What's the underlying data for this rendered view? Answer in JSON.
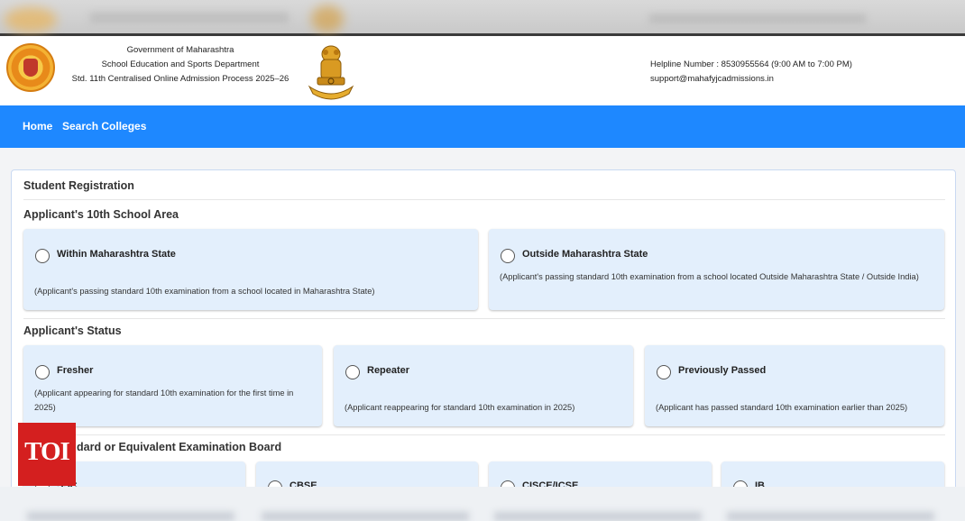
{
  "header": {
    "org_lines": [
      "Government of Maharashtra",
      "School Education and Sports Department",
      "Std. 11th Centralised Online Admission Process 2025–26"
    ],
    "helpline": "Helpline Number : 8530955564 (9:00 AM to 7:00 PM)",
    "email": "support@mahafyjcadmissions.in",
    "seal_icon": "maharashtra-seal-icon",
    "emblem_icon": "national-emblem-icon"
  },
  "nav": {
    "home": "Home",
    "search_colleges": "Search Colleges",
    "color": "#1e88ff"
  },
  "form": {
    "title": "Student Registration",
    "area": {
      "heading": "Applicant's 10th School Area",
      "options": [
        {
          "label": "Within Maharashtra State",
          "desc": "(Applicant's passing standard 10th examination from a school located in Maharashtra State)"
        },
        {
          "label": "Outside Maharashtra State",
          "desc": "(Applicant's passing standard 10th examination from a school located Outside Maharashtra State / Outside India)"
        }
      ]
    },
    "status": {
      "heading": "Applicant's Status",
      "options": [
        {
          "label": "Fresher",
          "desc": "(Applicant appearing for standard 10th examination for the first time in 2025)"
        },
        {
          "label": "Repeater",
          "desc": "(Applicant reappearing for standard 10th examination in 2025)"
        },
        {
          "label": "Previously Passed",
          "desc": "(Applicant has passed standard 10th examination earlier than 2025)"
        }
      ]
    },
    "board": {
      "heading": "Standard or Equivalent Examination Board",
      "visible_heading": "dard or Equivalent Examination Board",
      "options": [
        {
          "label": "SSC"
        },
        {
          "label": "CBSE"
        },
        {
          "label": "CISCE/ICSE"
        },
        {
          "label": "IB"
        }
      ]
    }
  },
  "watermark": "TOI"
}
